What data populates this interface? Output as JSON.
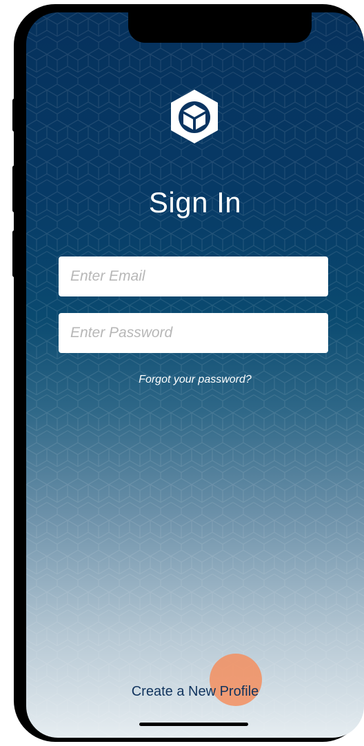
{
  "screen": {
    "title": "Sign In",
    "logo_icon": "hexagon-cube-logo-icon"
  },
  "form": {
    "email": {
      "placeholder": "Enter Email",
      "value": ""
    },
    "password": {
      "placeholder": "Enter Password",
      "value": ""
    },
    "forgot_label": "Forgot your password?"
  },
  "footer": {
    "create_label": "Create a New Profile"
  },
  "colors": {
    "top_gradient": "#06315c",
    "bottom_gradient": "#e6edf1",
    "create_link": "#10335d",
    "touch_indicator": "#f58c5a"
  }
}
